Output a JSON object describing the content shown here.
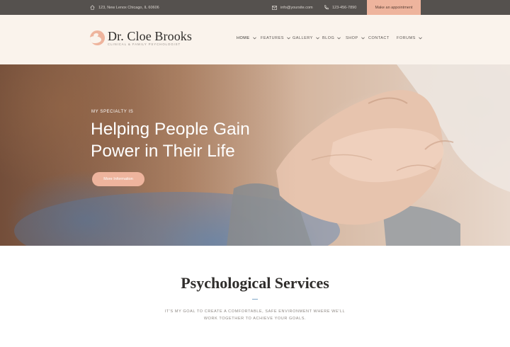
{
  "topbar": {
    "address": "123, New Lenox Chicago, IL 60606",
    "email": "info@yoursite.com",
    "phone": "123-456-7890",
    "appointment_label": "Make an appointment"
  },
  "brand": {
    "name": "Dr. Cloe Brooks",
    "tagline": "CLINICAL & FAMILY PSYCHOLOGIST"
  },
  "nav": {
    "items": [
      {
        "label": "HOME",
        "dropdown": true,
        "active": true
      },
      {
        "label": "FEATURES",
        "dropdown": true
      },
      {
        "label": "GALLERY",
        "dropdown": true
      },
      {
        "label": "BLOG",
        "dropdown": true
      },
      {
        "label": "SHOP",
        "dropdown": true
      },
      {
        "label": "CONTACT",
        "dropdown": false
      },
      {
        "label": "FORUMS",
        "dropdown": true
      }
    ]
  },
  "hero": {
    "kicker": "MY SPECIALTY IS",
    "title": "Helping People Gain Power in Their Life",
    "button_label": "More Information"
  },
  "services": {
    "title": "Psychological Services",
    "description": "IT'S MY GOAL TO CREATE A COMFORTABLE, SAFE ENVIRONMENT WHERE WE'LL WORK TOGETHER TO ACHIEVE YOUR GOALS."
  },
  "colors": {
    "accent": "#eeb49d",
    "topbar_bg": "#55514e",
    "header_bg": "#faf3ec",
    "divider": "#7fa7c8"
  },
  "icons": {
    "address": "home-icon",
    "email": "envelope-icon",
    "phone": "phone-icon"
  }
}
